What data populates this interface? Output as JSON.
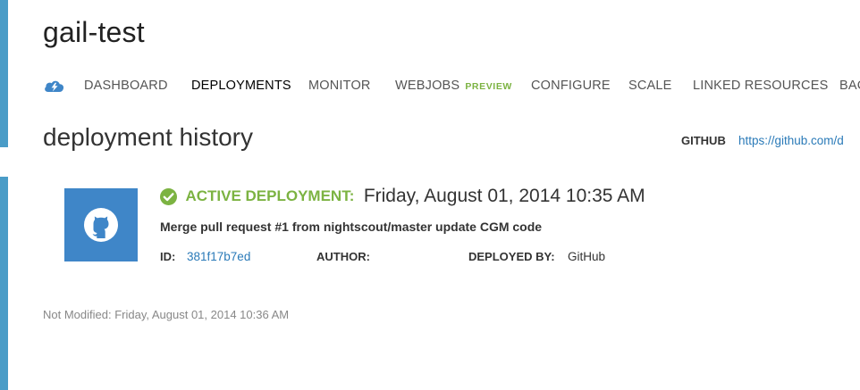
{
  "app": {
    "title": "gail-test"
  },
  "nav": {
    "logo_icon": "cloud-lightning-icon",
    "items": [
      {
        "label": "DASHBOARD"
      },
      {
        "label": "DEPLOYMENTS",
        "active": true
      },
      {
        "label": "MONITOR"
      },
      {
        "label": "WEBJOBS",
        "badge": "PREVIEW"
      },
      {
        "label": "CONFIGURE"
      },
      {
        "label": "SCALE"
      },
      {
        "label": "LINKED RESOURCES"
      },
      {
        "label": "BAC"
      }
    ]
  },
  "section": {
    "title": "deployment history",
    "source_label": "GITHUB",
    "source_link": "https://github.com/d"
  },
  "deployment": {
    "thumb_icon": "github-icon",
    "status_icon": "check-circle-icon",
    "status_label": "ACTIVE DEPLOYMENT:",
    "date": "Friday, August 01, 2014 10:35 AM",
    "message": "Merge pull request #1 from nightscout/master update CGM code",
    "id_label": "ID:",
    "id_value": "381f17b7ed",
    "author_label": "AUTHOR:",
    "author_value": "",
    "deployed_by_label": "DEPLOYED BY:",
    "deployed_by_value": "GitHub"
  },
  "footer": {
    "note": "Not Modified: Friday, August 01, 2014 10:36 AM"
  },
  "colors": {
    "accent": "#4a9cc7",
    "success": "#7cb342",
    "link": "#2a7ab8",
    "thumb": "#3f86c8"
  }
}
